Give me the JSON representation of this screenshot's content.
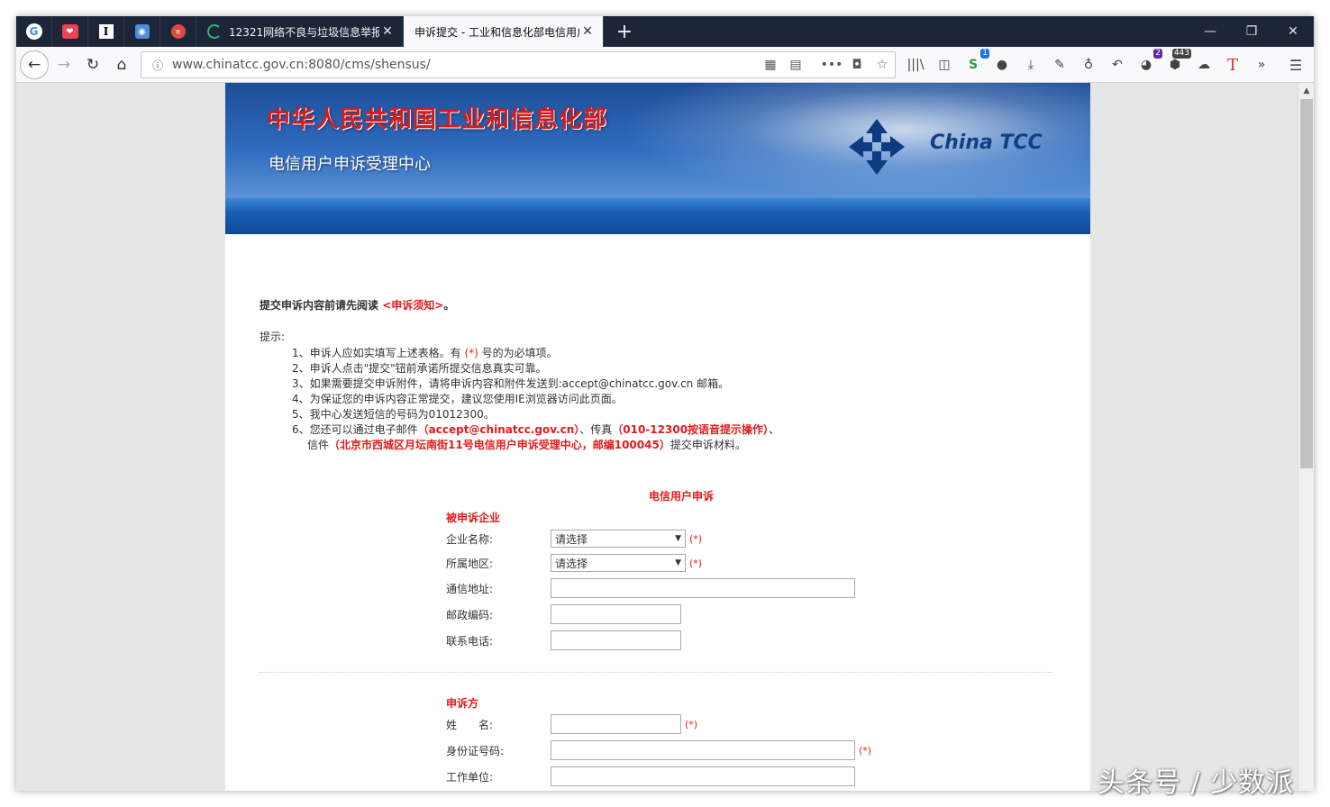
{
  "browser": {
    "tabs": [
      {
        "title": "12321网络不良与垃圾信息举报"
      },
      {
        "title": "申诉提交 - 工业和信息化部电信用户"
      }
    ],
    "url": "www.chinatcc.gov.cn:8080/cms/shensus/",
    "badges": {
      "sync": "1",
      "ext_a": "2",
      "ext_b": "443"
    }
  },
  "banner": {
    "title": "中华人民共和国工业和信息化部",
    "subtitle": "电信用户申诉受理中心",
    "brand": "China TCC"
  },
  "notice": {
    "prefix": "提交申诉内容前请先阅读",
    "link": "<申诉须知>",
    "suffix": "。"
  },
  "tips": {
    "title": "提示:",
    "items": {
      "i1_a": "1、申诉人应如实填写上述表格。有 ",
      "i1_req": "(*)",
      "i1_b": " 号的为必填项。",
      "i2": "2、申诉人点击\"提交\"钮前承诺所提交信息真实可靠。",
      "i3": "3、如果需要提交申诉附件，请将申诉内容和附件发送到:accept@chinatcc.gov.cn 邮箱。",
      "i4": "4、为保证您的申诉内容正常提交，建议您使用IE浏览器访问此页面。",
      "i5": "5、我中心发送短信的号码为01012300。",
      "i6_a": "6、您还可以通过电子邮件",
      "i6_email": "（accept@chinatcc.gov.cn）",
      "i6_b": "、传真",
      "i6_fax": "（010-12300按语音提示操作）",
      "i6_c": "、",
      "i6_d": "信件",
      "i6_addr": "（北京市西城区月坛南街11号电信用户申诉受理中心，邮编100045）",
      "i6_e": "提交申诉材料。"
    }
  },
  "form": {
    "title": "电信用户申诉",
    "required_mark": "(*)",
    "section1": "被申诉企业",
    "company_label": "企业名称:",
    "company_value": "请选择",
    "region_label": "所属地区:",
    "region_value": "请选择",
    "address_label": "通信地址:",
    "postcode_label": "邮政编码:",
    "phone_label": "联系电话:",
    "section2": "申诉方",
    "name_label": "姓　　名:",
    "id_label": "身份证号码:",
    "work_label": "工作单位:"
  },
  "watermark": "头条号 / 少数派",
  "colors": {
    "accent_red": "#e31b1b",
    "tab_strip": "#1d2638",
    "banner_blue": "#1e4e98"
  }
}
